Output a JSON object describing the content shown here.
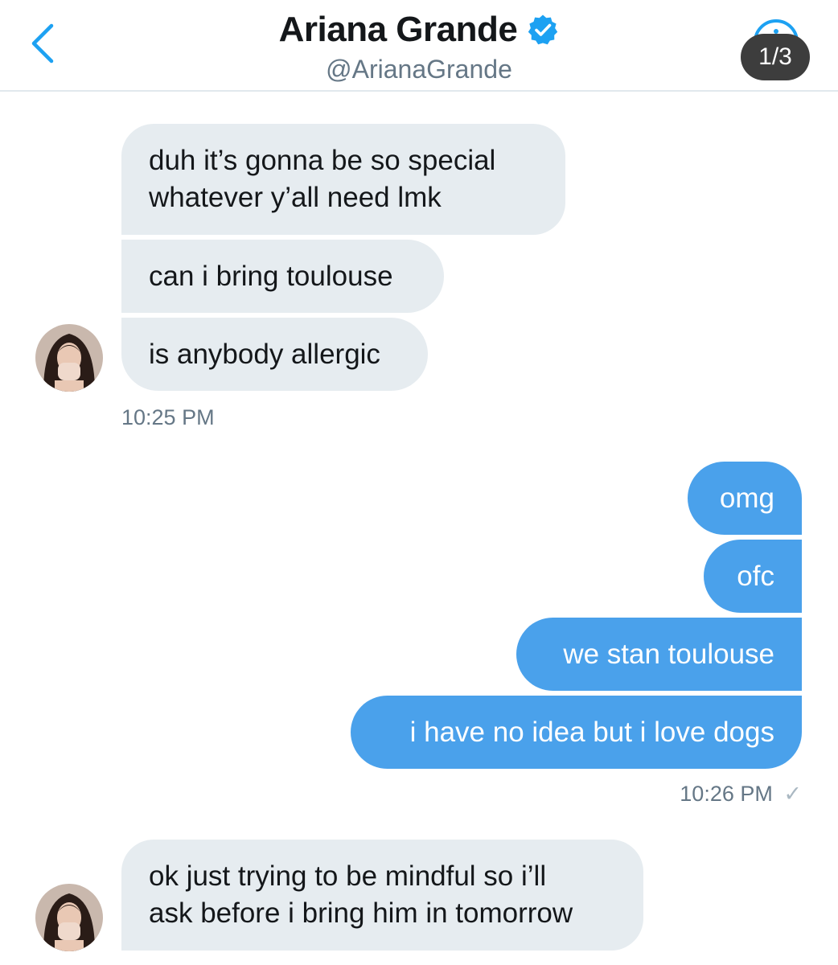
{
  "header": {
    "title": "Ariana Grande",
    "handle": "@ArianaGrande",
    "page_counter": "1/3",
    "verified": true
  },
  "icons": {
    "back": "chevron-left-icon",
    "verified": "verified-badge-icon",
    "info": "info-icon"
  },
  "colors": {
    "accent": "#1da1f2",
    "outgoing_bubble": "#4aa1eb",
    "incoming_bubble": "#e6ecf0",
    "meta_text": "#657786"
  },
  "messages": {
    "group1": {
      "m1": [
        "duh it’s gonna be so special",
        "whatever y’all need lmk"
      ],
      "m2": "can i bring toulouse",
      "m3": "is anybody allergic",
      "time": "10:25 PM"
    },
    "group2": {
      "m1": "omg",
      "m2": "ofc",
      "m3": "we stan toulouse",
      "m4": "i have no idea but i love dogs",
      "time": "10:26 PM",
      "status": "✓"
    },
    "group3": {
      "m1": [
        "ok just trying to be mindful so i’ll",
        "ask before i bring him in tomorrow"
      ]
    }
  }
}
